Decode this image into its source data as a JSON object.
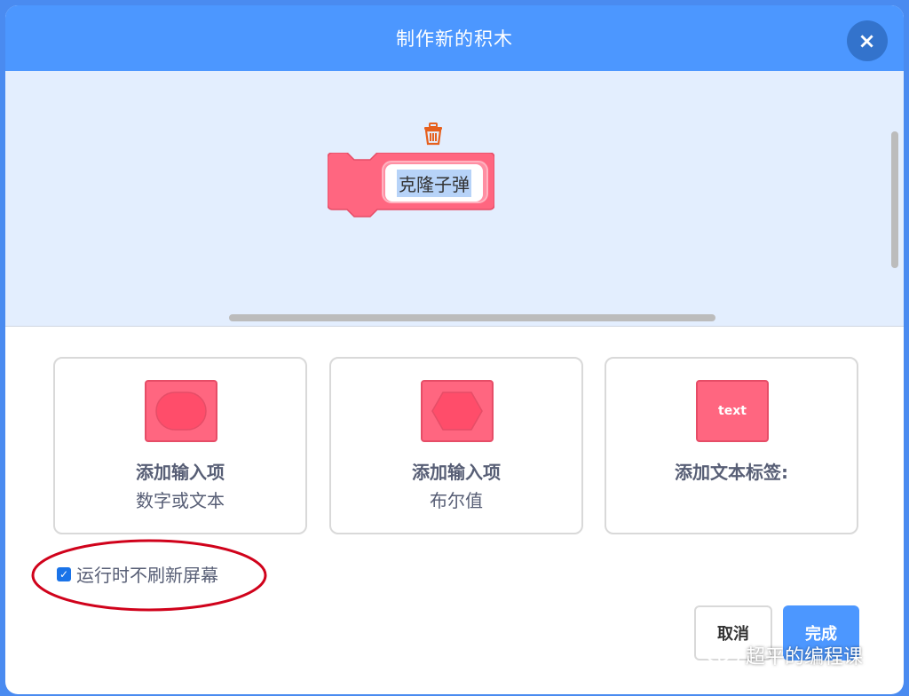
{
  "dialog": {
    "title": "制作新的积木",
    "close_glyph": "×"
  },
  "workspace": {
    "block_name": "克隆子弹",
    "block_color": "#ff6680",
    "trash_icon": "trash-icon"
  },
  "options": [
    {
      "title": "添加输入项",
      "subtitle": "数字或文本",
      "icon": "round-input-icon"
    },
    {
      "title": "添加输入项",
      "subtitle": "布尔值",
      "icon": "boolean-input-icon"
    },
    {
      "title": "添加文本标签:",
      "subtitle": "",
      "icon": "text-label-icon",
      "icon_text": "text"
    }
  ],
  "checkbox": {
    "label": "运行时不刷新屏幕",
    "checked": true
  },
  "buttons": {
    "cancel": "取消",
    "done": "完成"
  },
  "watermark": {
    "text": "超平的编程课"
  },
  "colors": {
    "header": "#4c97ff",
    "block": "#ff6680",
    "annotation": "#d0021b"
  }
}
